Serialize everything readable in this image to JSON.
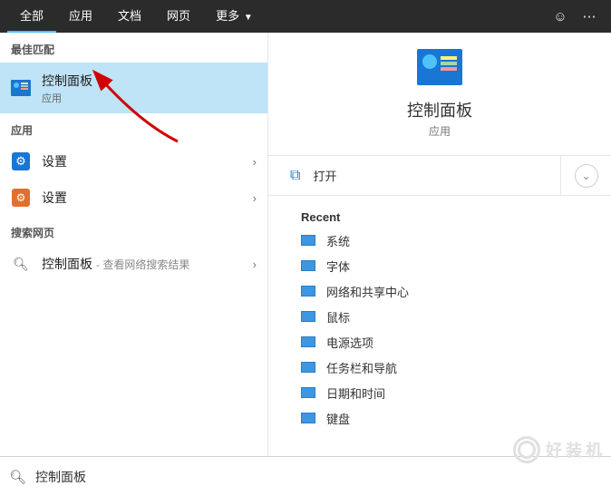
{
  "topbar": {
    "tabs": [
      "全部",
      "应用",
      "文档",
      "网页",
      "更多"
    ],
    "active_index": 0
  },
  "left": {
    "best_match_label": "最佳匹配",
    "best_match": {
      "title": "控制面板",
      "sub": "应用"
    },
    "apps_label": "应用",
    "apps": [
      {
        "title": "设置"
      },
      {
        "title": "设置"
      }
    ],
    "web_label": "搜索网页",
    "web": {
      "title": "控制面板",
      "sub": "- 查看网络搜索结果"
    }
  },
  "right": {
    "preview": {
      "title": "控制面板",
      "sub": "应用"
    },
    "open_label": "打开",
    "recent_label": "Recent",
    "recent": [
      "系统",
      "字体",
      "网络和共享中心",
      "鼠标",
      "电源选项",
      "任务栏和导航",
      "日期和时间",
      "键盘"
    ]
  },
  "search": {
    "value": "控制面板"
  },
  "watermark": "好装机"
}
